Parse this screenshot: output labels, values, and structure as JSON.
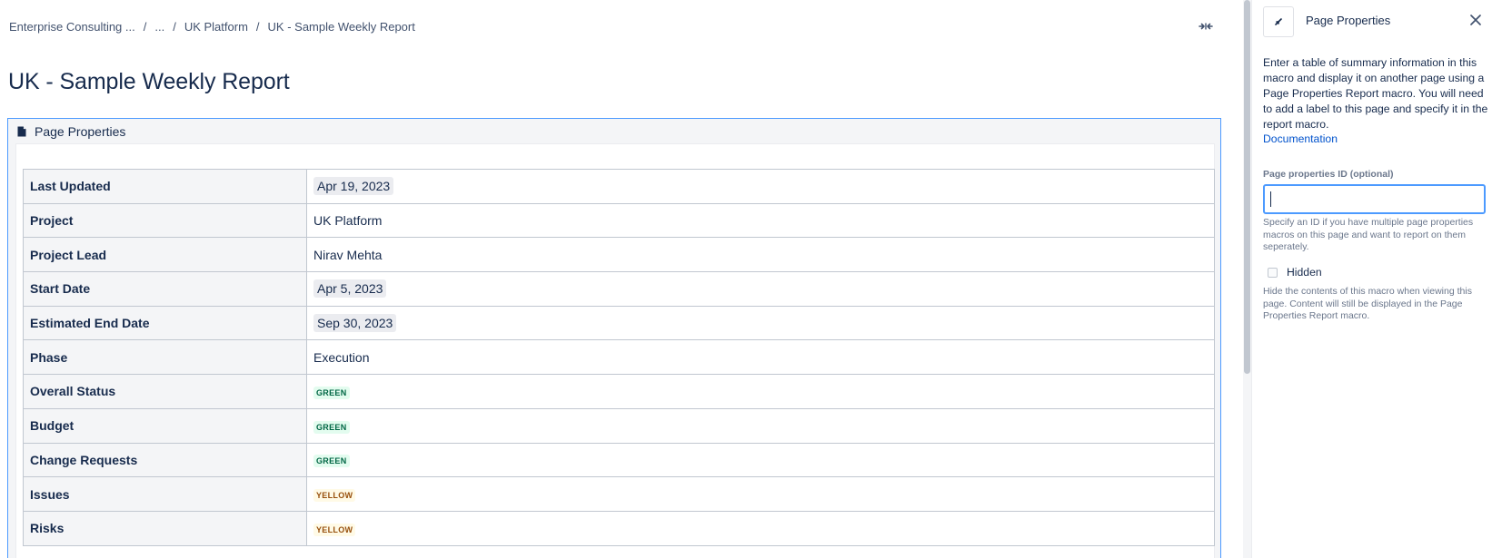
{
  "breadcrumb": {
    "items": [
      "Enterprise Consulting ...",
      "...",
      "UK Platform",
      "UK - Sample Weekly Report"
    ],
    "separator": "/"
  },
  "page": {
    "title": "UK - Sample Weekly Report"
  },
  "macro": {
    "header_label": "Page Properties",
    "rows": [
      {
        "key": "Last Updated",
        "value": "Apr 19, 2023",
        "kind": "date"
      },
      {
        "key": "Project",
        "value": "UK Platform",
        "kind": "text"
      },
      {
        "key": "Project Lead",
        "value": "Nirav Mehta",
        "kind": "text"
      },
      {
        "key": "Start Date",
        "value": "Apr 5, 2023",
        "kind": "date"
      },
      {
        "key": "Estimated End Date",
        "value": "Sep 30, 2023",
        "kind": "date"
      },
      {
        "key": "Phase",
        "value": "Execution",
        "kind": "text"
      },
      {
        "key": "Overall Status",
        "value": "GREEN",
        "kind": "status-green"
      },
      {
        "key": "Budget",
        "value": "GREEN",
        "kind": "status-green"
      },
      {
        "key": "Change Requests",
        "value": "GREEN",
        "kind": "status-green"
      },
      {
        "key": "Issues",
        "value": "YELLOW",
        "kind": "status-yellow"
      },
      {
        "key": "Risks",
        "value": "YELLOW",
        "kind": "status-yellow"
      }
    ]
  },
  "panel": {
    "title": "Page Properties",
    "icon": "macro-icon",
    "description": "Enter a table of summary information in this macro and display it on another page using a Page Properties Report macro. You will need to add a label to this page and specify it in the report macro.",
    "documentation_link": "Documentation",
    "id_field": {
      "label": "Page properties ID (optional)",
      "value": "",
      "help": "Specify an ID if you have multiple page properties macros on this page and want to report on them seperately."
    },
    "hidden_option": {
      "label": "Hidden",
      "checked": false,
      "help": "Hide the contents of this macro when viewing this page. Content will still be displayed in the Page Properties Report macro."
    }
  },
  "colors": {
    "status_green_bg": "#e3fcef",
    "status_green_text": "#006644",
    "status_yellow_bg": "#fffae6",
    "status_yellow_text": "#974f0c",
    "link": "#0052cc",
    "focus_border": "#4c9aff"
  }
}
